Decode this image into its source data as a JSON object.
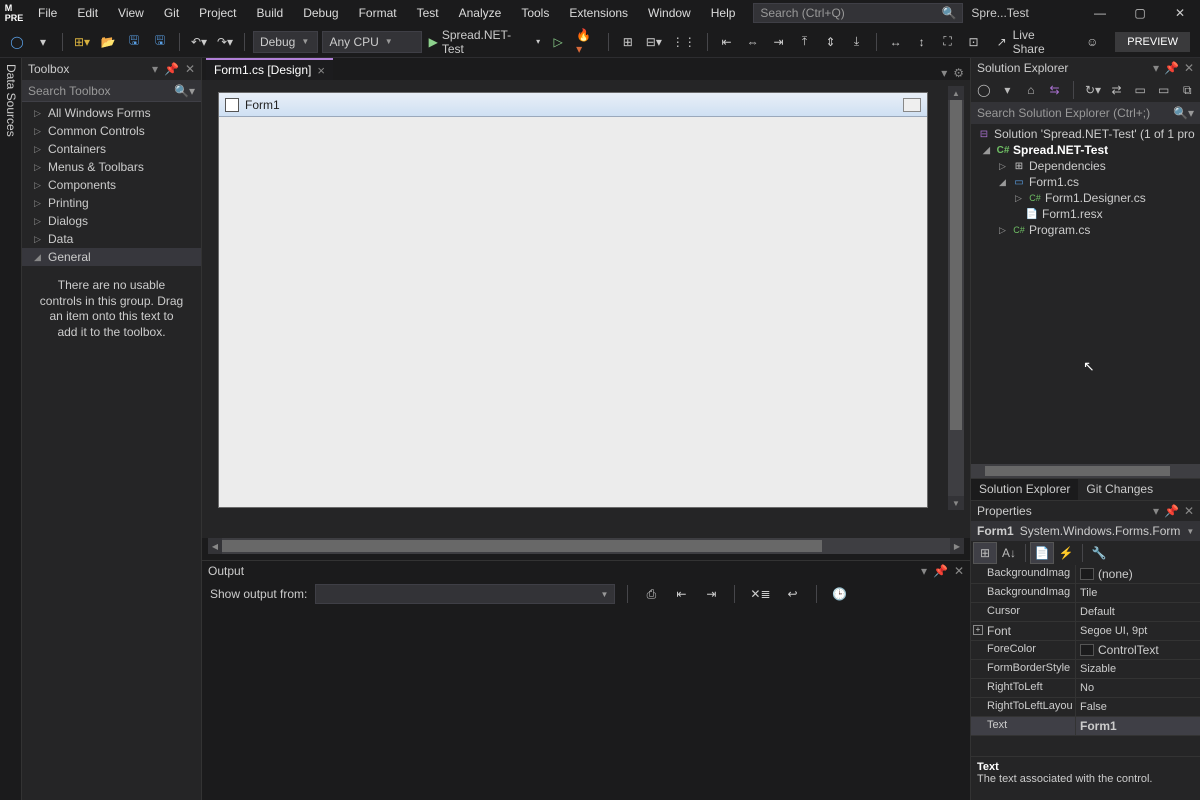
{
  "titlebar": {
    "menus": [
      "File",
      "Edit",
      "View",
      "Git",
      "Project",
      "Build",
      "Debug",
      "Format",
      "Test",
      "Analyze",
      "Tools",
      "Extensions",
      "Window",
      "Help"
    ],
    "search_placeholder": "Search (Ctrl+Q)",
    "window_title": "Spre...Test"
  },
  "toolbar": {
    "config": "Debug",
    "platform": "Any CPU",
    "run_target": "Spread.NET-Test",
    "live_share": "Live Share",
    "preview": "PREVIEW"
  },
  "rail_label": "Data Sources",
  "toolbox": {
    "title": "Toolbox",
    "search_placeholder": "Search Toolbox",
    "items": [
      {
        "label": "All Windows Forms",
        "exp": false
      },
      {
        "label": "Common Controls",
        "exp": false
      },
      {
        "label": "Containers",
        "exp": false
      },
      {
        "label": "Menus & Toolbars",
        "exp": false
      },
      {
        "label": "Components",
        "exp": false
      },
      {
        "label": "Printing",
        "exp": false
      },
      {
        "label": "Dialogs",
        "exp": false
      },
      {
        "label": "Data",
        "exp": false
      },
      {
        "label": "General",
        "exp": true
      }
    ],
    "empty_msg": "There are no usable controls in this group. Drag an item onto this text to add it to the toolbox."
  },
  "document": {
    "tab": "Form1.cs [Design]",
    "form_title": "Form1"
  },
  "output": {
    "title": "Output",
    "show_from": "Show output from:"
  },
  "solution_explorer": {
    "title": "Solution Explorer",
    "search_placeholder": "Search Solution Explorer (Ctrl+;)",
    "solution": "Solution 'Spread.NET-Test' (1 of 1 pro",
    "project": "Spread.NET-Test",
    "nodes": {
      "deps": "Dependencies",
      "form": "Form1.cs",
      "designer": "Form1.Designer.cs",
      "resx": "Form1.resx",
      "program": "Program.cs"
    },
    "tabs": [
      "Solution Explorer",
      "Git Changes"
    ]
  },
  "properties": {
    "title": "Properties",
    "object_name": "Form1",
    "object_type": "System.Windows.Forms.Form",
    "rows": [
      {
        "name": "BackgroundImag",
        "value": "(none)",
        "swatch": true
      },
      {
        "name": "BackgroundImag",
        "value": "Tile"
      },
      {
        "name": "Cursor",
        "value": "Default"
      },
      {
        "name": "Font",
        "value": "Segoe UI, 9pt",
        "exp": true
      },
      {
        "name": "ForeColor",
        "value": "ControlText",
        "swatch": true
      },
      {
        "name": "FormBorderStyle",
        "value": "Sizable"
      },
      {
        "name": "RightToLeft",
        "value": "No"
      },
      {
        "name": "RightToLeftLayou",
        "value": "False"
      },
      {
        "name": "Text",
        "value": "Form1",
        "sel": true,
        "bold": true
      }
    ],
    "desc_title": "Text",
    "desc_body": "The text associated with the control."
  }
}
